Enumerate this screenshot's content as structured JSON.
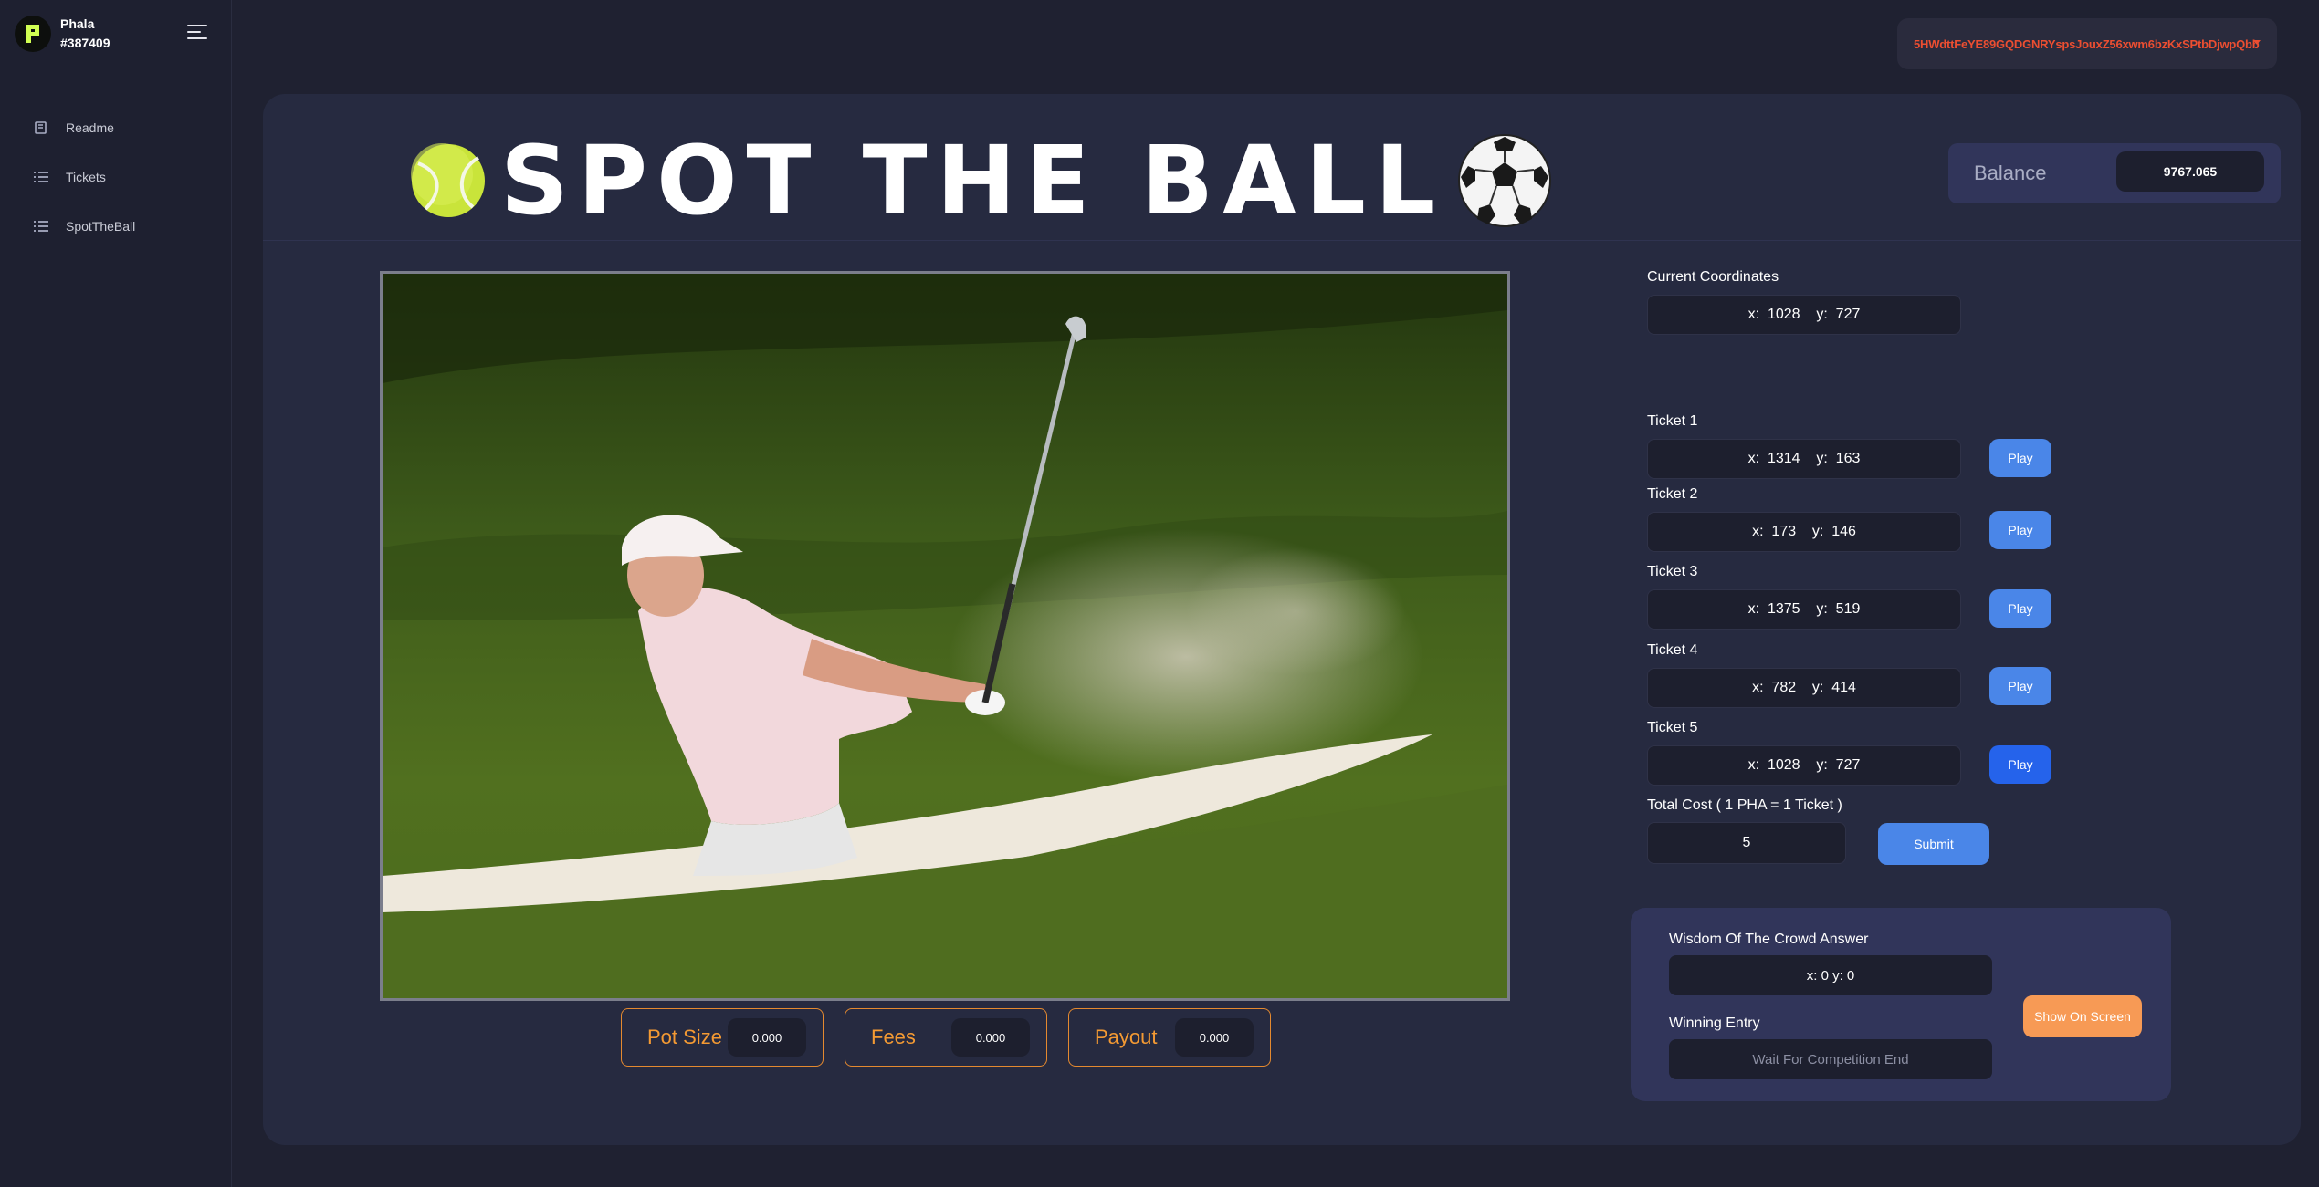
{
  "sidebar": {
    "account_name": "Phala",
    "account_id": "#387409",
    "items": [
      {
        "label": "Readme",
        "icon": "book-icon"
      },
      {
        "label": "Tickets",
        "icon": "list-icon"
      },
      {
        "label": "SpotTheBall",
        "icon": "list-icon"
      }
    ]
  },
  "topbar": {
    "wallet_address": "5HWdttFeYE89GQDGNRYspsJouxZ56xwm6bzKxSPtbDjwpQbb"
  },
  "hero": {
    "title": "SPOT THE BALL",
    "left_icon": "tennis-ball-icon",
    "right_icon": "soccer-ball-icon"
  },
  "balance": {
    "label": "Balance",
    "value": "9767.065"
  },
  "photo": {
    "description_icon": "golf-photo"
  },
  "stats": {
    "pot_size_label": "Pot Size",
    "pot_size_value": "0.000",
    "fees_label": "Fees",
    "fees_value": "0.000",
    "payout_label": "Payout",
    "payout_value": "0.000"
  },
  "current": {
    "label": "Current Coordinates",
    "value": "x:  1028    y:  727"
  },
  "tickets": [
    {
      "label": "Ticket 1",
      "value": "x:  1314    y:  163",
      "button": "Play"
    },
    {
      "label": "Ticket 2",
      "value": "x:  173    y:  146",
      "button": "Play"
    },
    {
      "label": "Ticket 3",
      "value": "x:  1375    y:  519",
      "button": "Play"
    },
    {
      "label": "Ticket 4",
      "value": "x:  782    y:  414",
      "button": "Play"
    },
    {
      "label": "Ticket 5",
      "value": "x:  1028    y:  727",
      "button": "Play"
    }
  ],
  "cost": {
    "label": "Total Cost ( 1 PHA = 1 Ticket )",
    "value": "5",
    "submit_label": "Submit"
  },
  "crowd": {
    "answer_label": "Wisdom Of The Crowd Answer",
    "answer_value": "x: 0 y: 0",
    "winning_label": "Winning Entry",
    "winning_placeholder": "Wait For Competition End",
    "show_button": "Show On Screen"
  },
  "colors": {
    "accent_blue": "#4a86e8",
    "accent_orange": "#f49a33",
    "wallet_red": "#ec4e31",
    "show_button": "#f79a55"
  }
}
